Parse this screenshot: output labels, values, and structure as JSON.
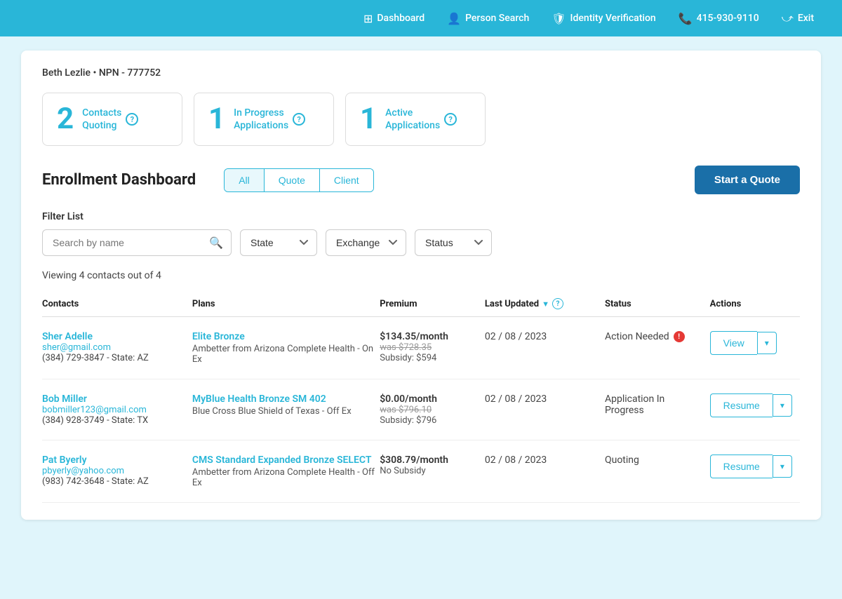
{
  "nav": {
    "items": [
      {
        "label": "Dashboard",
        "icon": "grid-icon"
      },
      {
        "label": "Person Search",
        "icon": "person-icon"
      },
      {
        "label": "Identity Verification",
        "icon": "shield-icon"
      },
      {
        "label": "415-930-9110",
        "icon": "phone-icon"
      },
      {
        "label": "Exit",
        "icon": "exit-icon"
      }
    ]
  },
  "agent": {
    "name": "Beth Lezlie",
    "npn_label": "NPN -",
    "npn": "777752"
  },
  "stats": [
    {
      "number": "2",
      "label": "Contacts\nQuoting"
    },
    {
      "number": "1",
      "label": "In Progress\nApplications"
    },
    {
      "number": "1",
      "label": "Active\nApplications"
    }
  ],
  "dashboard": {
    "title": "Enrollment Dashboard",
    "tabs": [
      {
        "label": "All",
        "active": true
      },
      {
        "label": "Quote"
      },
      {
        "label": "Client"
      }
    ],
    "start_quote_btn": "Start a Quote"
  },
  "filter": {
    "label": "Filter List",
    "search_placeholder": "Search by name",
    "dropdowns": [
      {
        "label": "State",
        "value": "State"
      },
      {
        "label": "Exchange",
        "value": "Exchange"
      },
      {
        "label": "Status",
        "value": "Status"
      }
    ]
  },
  "table": {
    "viewing_text": "Viewing 4 contacts out of 4",
    "columns": [
      {
        "label": "Contacts"
      },
      {
        "label": "Plans"
      },
      {
        "label": "Premium"
      },
      {
        "label": "Last Updated",
        "sortable": true,
        "help": true
      },
      {
        "label": "Status"
      },
      {
        "label": "Actions"
      }
    ],
    "rows": [
      {
        "contact_name": "Sher Adelle",
        "contact_email": "sher@gmail.com",
        "contact_phone": "(384) 729-3847 - State: AZ",
        "plan_name": "Elite Bronze",
        "plan_provider": "Ambetter from Arizona Complete Health - On Ex",
        "premium": "$134.35/month",
        "premium_was": "was $728.35",
        "subsidy": "Subsidy: $594",
        "last_updated": "02 / 08 / 2023",
        "status": "Action Needed",
        "status_error": true,
        "action_btn": "View"
      },
      {
        "contact_name": "Bob Miller",
        "contact_email": "bobmiller123@gmail.com",
        "contact_phone": "(384) 928-3749 - State: TX",
        "plan_name": "MyBlue Health Bronze SM 402",
        "plan_provider": "Blue Cross Blue Shield of Texas - Off Ex",
        "premium": "$0.00/month",
        "premium_was": "was $796.10",
        "subsidy": "Subsidy: $796",
        "last_updated": "02 / 08 / 2023",
        "status": "Application In\nProgress",
        "status_error": false,
        "action_btn": "Resume"
      },
      {
        "contact_name": "Pat Byerly",
        "contact_email": "pbyerly@yahoo.com",
        "contact_phone": "(983) 742-3648 - State: AZ",
        "plan_name": "CMS Standard Expanded Bronze SELECT",
        "plan_provider": "Ambetter from Arizona Complete Health - Off Ex",
        "premium": "$308.79/month",
        "premium_was": "",
        "subsidy": "No Subsidy",
        "last_updated": "02 / 08 / 2023",
        "status": "Quoting",
        "status_error": false,
        "action_btn": "Resume"
      }
    ]
  }
}
